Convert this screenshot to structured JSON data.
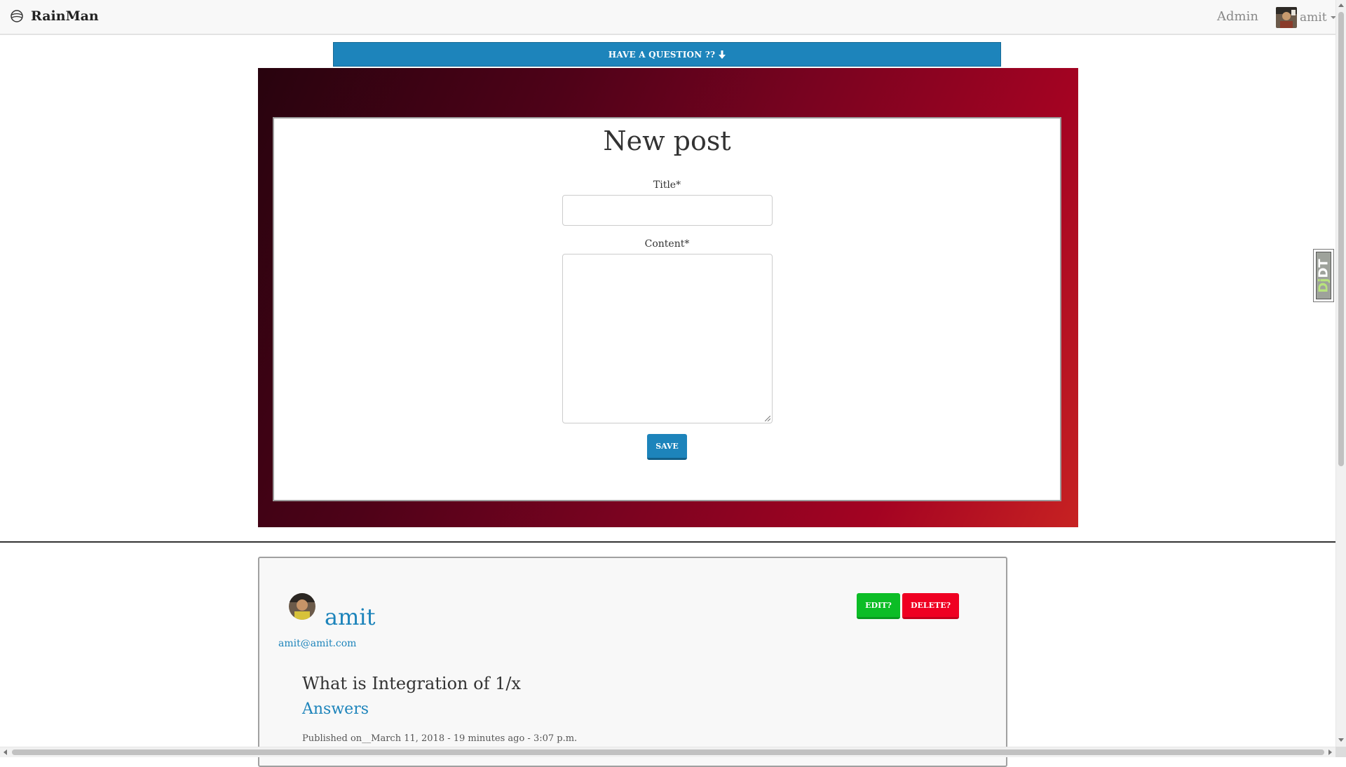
{
  "navbar": {
    "brand": "RainMan",
    "brand_icon": "globe-icon",
    "admin_label": "Admin",
    "user_name": "amit",
    "user_caret_icon": "caret-down-icon"
  },
  "ask_bar": {
    "label": "HAVE A QUESTION ??",
    "icon": "arrow-down-icon"
  },
  "form": {
    "heading": "New post",
    "title_label": "Title*",
    "title_value": "",
    "content_label": "Content*",
    "content_value": "",
    "save_label": "SAVE"
  },
  "debug_toolbar": {
    "dj": "Dj",
    "dt": "DT"
  },
  "post": {
    "author": "amit",
    "email": "amit@amit.com",
    "edit_label": "EDIT?",
    "delete_label": "DELETE?",
    "title": "What is Integration of 1/x",
    "answers_label": "Answers",
    "published_text": "Published on__March 11, 2018 - 19 minutes ago - 3:07 p.m."
  },
  "colors": {
    "primary": "#1d84bb",
    "success": "#0cbd26",
    "danger": "#ef0022",
    "hero_start": "#28030e",
    "hero_end": "#c72222"
  }
}
